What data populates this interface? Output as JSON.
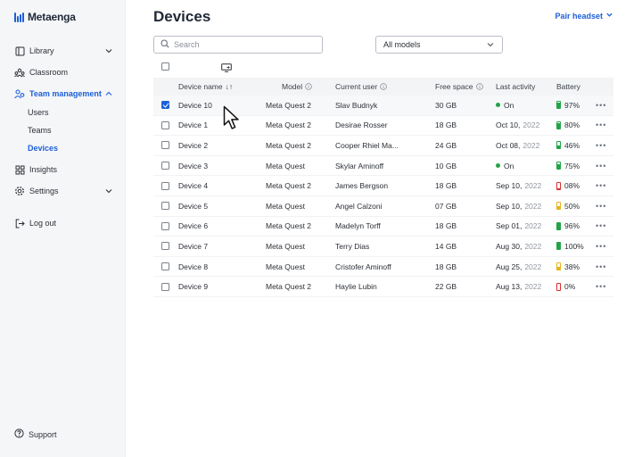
{
  "app": {
    "name": "Metaenga",
    "brand_color": "#1c5fd9"
  },
  "sidebar": {
    "items": [
      {
        "label": "Library",
        "icon": "library-icon",
        "has_chevron": "down"
      },
      {
        "label": "Classroom",
        "icon": "classroom-icon"
      },
      {
        "label": "Team management",
        "icon": "team-icon",
        "has_chevron": "up",
        "active": true
      },
      {
        "label": "Insights",
        "icon": "insights-icon"
      },
      {
        "label": "Settings",
        "icon": "gear-icon",
        "has_chevron": "down"
      },
      {
        "label": "Log out",
        "icon": "logout-icon"
      }
    ],
    "subitems": [
      {
        "label": "Users"
      },
      {
        "label": "Teams"
      },
      {
        "label": "Devices",
        "active": true
      }
    ],
    "support_label": "Support"
  },
  "header": {
    "title": "Devices",
    "pair_label": "Pair headset"
  },
  "filters": {
    "search_placeholder": "Search",
    "model_select": "All models"
  },
  "table": {
    "columns": {
      "name": "Device name",
      "model": "Model",
      "user": "Current user",
      "free": "Free space",
      "activity": "Last activity",
      "battery": "Battery"
    },
    "sort_icon": "↓↑",
    "rows": [
      {
        "name": "Device 10",
        "model": "Meta Quest 2",
        "user": "Slav Budnyk",
        "free": "30 GB",
        "activity": "On",
        "online": true,
        "battery": "97%",
        "level": 0.97,
        "color": "#22a447",
        "selected": true
      },
      {
        "name": "Device 1",
        "model": "Meta Quest 2",
        "user": "Desirae Rosser",
        "free": "18 GB",
        "activity": "Oct 10,",
        "year": "2022",
        "battery": "80%",
        "level": 0.8,
        "color": "#22a447"
      },
      {
        "name": "Device 2",
        "model": "Meta Quest 2",
        "user": "Cooper Rhiel Ma...",
        "free": "24 GB",
        "activity": "Oct 08,",
        "year": "2022",
        "battery": "46%",
        "level": 0.46,
        "color": "#22a447"
      },
      {
        "name": "Device 3",
        "model": "Meta Quest",
        "user": "Skylar Aminoff",
        "free": "10 GB",
        "activity": "On",
        "online": true,
        "battery": "75%",
        "level": 0.75,
        "color": "#22a447"
      },
      {
        "name": "Device 4",
        "model": "Meta Quest 2",
        "user": "James Bergson",
        "free": "18 GB",
        "activity": "Sep 10,",
        "year": "2022",
        "battery": "08%",
        "level": 0.08,
        "color": "#e02d2d"
      },
      {
        "name": "Device 5",
        "model": "Meta Quest",
        "user": "Angel Calzoni",
        "free": "07 GB",
        "activity": "Sep 10,",
        "year": "2022",
        "battery": "50%",
        "level": 0.5,
        "color": "#e8b21a"
      },
      {
        "name": "Device 6",
        "model": "Meta Quest 2",
        "user": "Madelyn Torff",
        "free": "18 GB",
        "activity": "Sep 01,",
        "year": "2022",
        "battery": "96%",
        "level": 0.96,
        "color": "#22a447"
      },
      {
        "name": "Device 7",
        "model": "Meta Quest",
        "user": "Terry Dias",
        "free": "14 GB",
        "activity": "Aug 30,",
        "year": "2022",
        "battery": "100%",
        "level": 1.0,
        "color": "#22a447"
      },
      {
        "name": "Device 8",
        "model": "Meta Quest",
        "user": "Cristofer Aminoff",
        "free": "18 GB",
        "activity": "Aug 25,",
        "year": "2022",
        "battery": "38%",
        "level": 0.38,
        "color": "#e8b21a"
      },
      {
        "name": "Device 9",
        "model": "Meta Quest 2",
        "user": "Haylie Lubin",
        "free": "22 GB",
        "activity": "Aug 13,",
        "year": "2022",
        "battery": "0%",
        "level": 0.0,
        "color": "#e02d2d"
      }
    ]
  }
}
